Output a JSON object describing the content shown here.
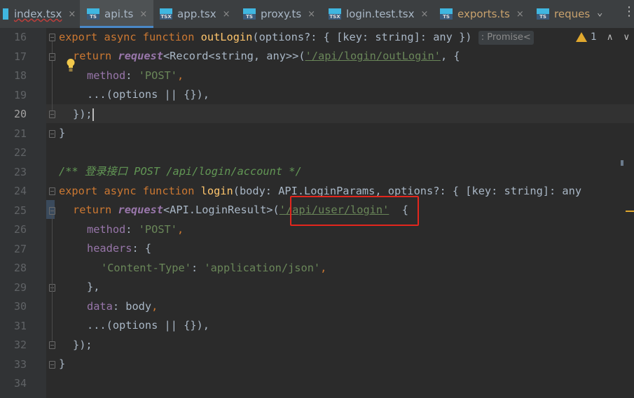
{
  "tabs": [
    {
      "label": "index.tsx",
      "icon": "tsx-file-icon",
      "state": "error"
    },
    {
      "label": "api.ts",
      "icon": "ts-file-icon",
      "state": "active"
    },
    {
      "label": "app.tsx",
      "icon": "tsx-file-icon",
      "state": "normal"
    },
    {
      "label": "proxy.ts",
      "icon": "ts-file-icon",
      "state": "normal"
    },
    {
      "label": "login.test.tsx",
      "icon": "tsx-file-icon",
      "state": "normal"
    },
    {
      "label": "exports.ts",
      "icon": "ts-file-icon",
      "state": "modified"
    },
    {
      "label": "reques",
      "icon": "ts-file-icon",
      "state": "modified"
    }
  ],
  "file_icon_text": {
    "ts": "TS",
    "tsx": "TSX"
  },
  "tab_close_glyph": "×",
  "tab_more_glyph": "⌄",
  "tab_menu_glyph": "⋮",
  "editor": {
    "current_line": 20,
    "lines": [
      16,
      17,
      18,
      19,
      20,
      21,
      22,
      23,
      24,
      25,
      26,
      27,
      28,
      29,
      30,
      31,
      32,
      33,
      34
    ],
    "inlay_hint": ": Promise<",
    "warnings_count": "1"
  },
  "code": {
    "l16_kw1": "export",
    "l16_kw2": "async",
    "l16_kw3": "function",
    "l16_fn": "outLogin",
    "l16_rest": "(options?: { [key: string]: any })",
    "l17_kw": "return",
    "l17_fn": "request",
    "l17_type": "<Record<string, any>>(",
    "l17_str": "'/api/login/outLogin'",
    "l17_rest": ", {",
    "l18_prop": "method",
    "l18_str": "'POST'",
    "l19": "...(options || {}),",
    "l20": "});",
    "l21": "}",
    "l23_cmt": "/** 登录接口 POST /api/login/account */",
    "l24_kw1": "export",
    "l24_kw2": "async",
    "l24_kw3": "function",
    "l24_fn": "login",
    "l24_rest": "(body: API.LoginParams, options?: { [key: string]: any",
    "l25_kw": "return",
    "l25_fn": "request",
    "l25_type": "<API.LoginResult>(",
    "l25_str": "'/api/user/login'",
    "l25_rest": "  {",
    "l26_prop": "method",
    "l26_str": "'POST'",
    "l27_prop": "headers",
    "l28_key": "'Content-Type'",
    "l28_val": "'application/json'",
    "l29": "},",
    "l30_prop": "data",
    "l30_val": "body",
    "l31": "...(options || {}),",
    "l32": "});",
    "l33": "}"
  },
  "colors": {
    "keyword": "#cc7832",
    "function": "#ffc66d",
    "string": "#6a8759",
    "property": "#9876aa",
    "comment": "#629755",
    "highlight_box": "#e3261d",
    "active_tab_underline": "#4a88c7"
  }
}
